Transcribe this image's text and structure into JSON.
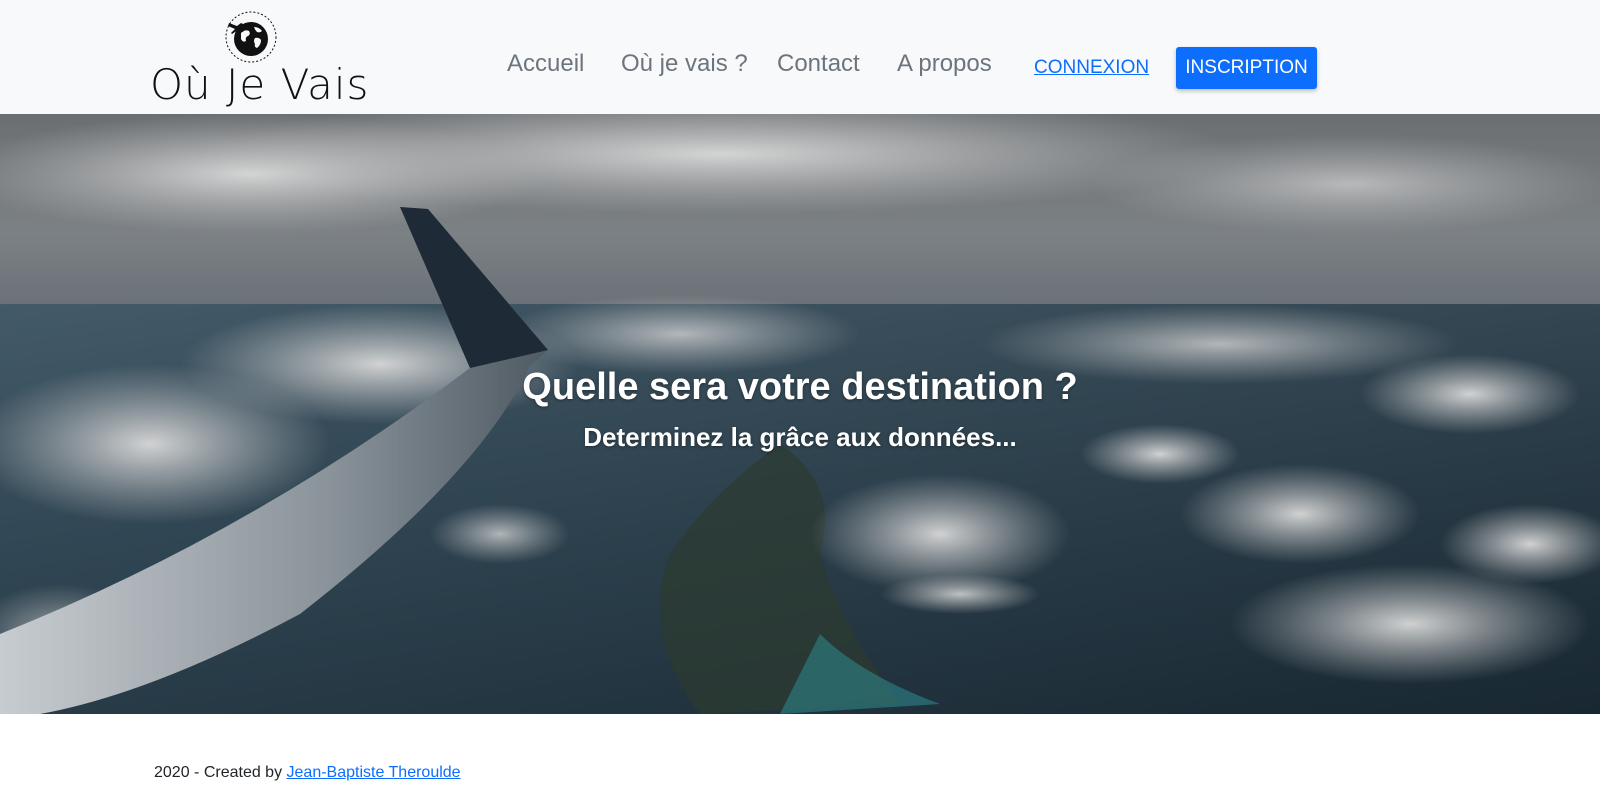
{
  "brand": {
    "name": "Où Je Vais",
    "logo_icon": "globe-airplane-icon"
  },
  "nav": {
    "links": [
      "Accueil",
      "Où je vais ?",
      "Contact",
      "A propos"
    ],
    "login": "CONNEXION",
    "signup": "INSCRIPTION"
  },
  "hero": {
    "title": "Quelle sera votre destination ?",
    "subtitle": "Determinez la grâce aux données..."
  },
  "footer": {
    "text": "2020 - Created by ",
    "author": "Jean-Baptiste Theroulde"
  },
  "colors": {
    "primary": "#0d6efd",
    "navbar_bg": "#f8f9fa",
    "nav_text": "#6c757d"
  }
}
